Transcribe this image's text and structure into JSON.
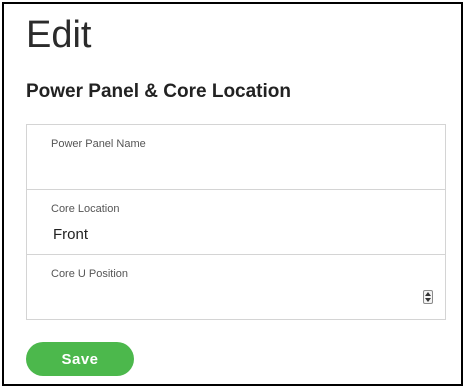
{
  "page": {
    "title": "Edit",
    "section_title": "Power Panel & Core Location"
  },
  "form": {
    "fields": [
      {
        "label": "Power Panel Name",
        "value": ""
      },
      {
        "label": "Core Location",
        "value": "Front"
      },
      {
        "label": "Core U Position",
        "value": ""
      }
    ]
  },
  "actions": {
    "save_label": "Save"
  },
  "colors": {
    "save_button": "#4cb84c",
    "border": "#d4d4d4"
  }
}
